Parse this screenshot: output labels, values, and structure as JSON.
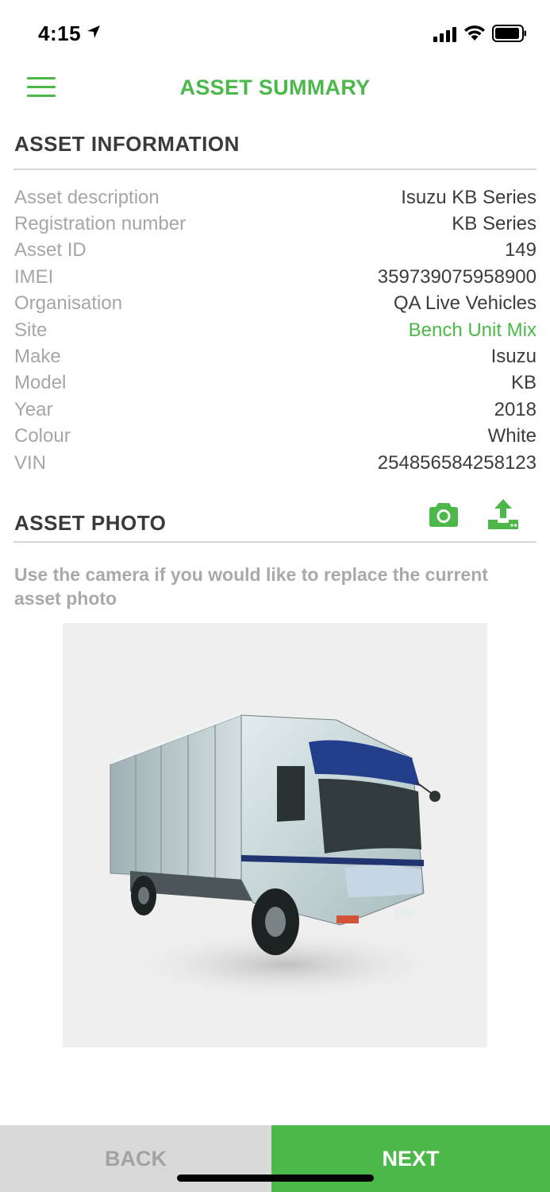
{
  "status_bar": {
    "time": "4:15"
  },
  "header": {
    "title": "ASSET SUMMARY",
    "menu_icon": "hamburger-menu-icon"
  },
  "asset_information": {
    "title": "ASSET INFORMATION",
    "rows": [
      {
        "label": "Asset description",
        "value": "Isuzu KB Series"
      },
      {
        "label": "Registration number",
        "value": "KB Series"
      },
      {
        "label": "Asset ID",
        "value": "149"
      },
      {
        "label": "IMEI",
        "value": "359739075958900"
      },
      {
        "label": "Organisation",
        "value": "QA Live Vehicles"
      },
      {
        "label": "Site",
        "value": "Bench Unit Mix",
        "link": true
      },
      {
        "label": "Make",
        "value": "Isuzu"
      },
      {
        "label": "Model",
        "value": "KB"
      },
      {
        "label": "Year",
        "value": "2018"
      },
      {
        "label": "Colour",
        "value": "White"
      },
      {
        "label": "VIN",
        "value": "254856584258123"
      }
    ]
  },
  "asset_photo": {
    "title": "ASSET PHOTO",
    "hint": "Use the camera if you would like to replace the current asset photo",
    "camera_icon": "camera-icon",
    "upload_icon": "upload-icon"
  },
  "footer": {
    "back_label": "BACK",
    "next_label": "NEXT"
  },
  "colors": {
    "accent": "#4cb84a",
    "label_gray": "#a6a6a6",
    "back_bg": "#d9d9d9"
  }
}
